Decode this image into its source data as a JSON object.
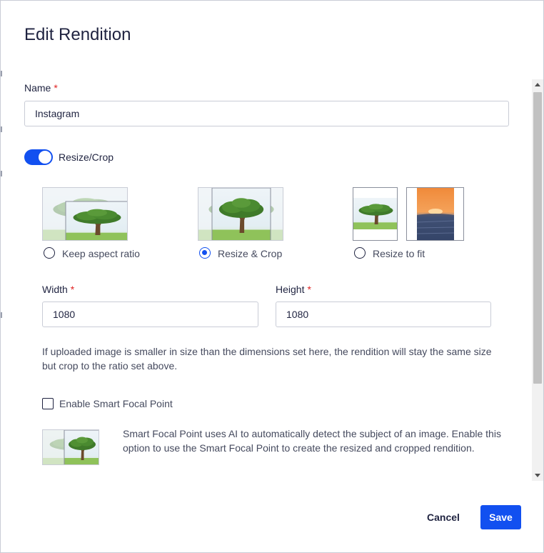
{
  "dialog": {
    "title": "Edit Rendition",
    "cancel_label": "Cancel",
    "save_label": "Save"
  },
  "form": {
    "name_label": "Name",
    "required_mark": "*",
    "name_value": "Instagram",
    "resize_crop_label": "Resize/Crop",
    "resize_crop_enabled": true,
    "options": [
      {
        "label": "Keep aspect ratio",
        "selected": false
      },
      {
        "label": "Resize & Crop",
        "selected": true
      },
      {
        "label": "Resize to fit",
        "selected": false
      }
    ],
    "width_label": "Width",
    "width_value": "1080",
    "height_label": "Height",
    "height_value": "1080",
    "size_note": "If uploaded image is smaller in size than the dimensions set here, the rendition will stay the same size but crop to the ratio set above.",
    "smart_focal_label": "Enable Smart Focal Point",
    "smart_focal_enabled": false,
    "smart_focal_description": "Smart Focal Point uses AI to automatically detect the subject of an image. Enable this option to use the Smart Focal Point to create the resized and cropped rendition."
  },
  "colors": {
    "accent": "#1250f0",
    "required": "#e02424",
    "text": "#1f2340"
  },
  "icons": {
    "keep_aspect_thumb": "tree-image-icon",
    "resize_crop_thumb": "tree-image-icon",
    "resize_fit_thumb_a": "tree-image-icon",
    "resize_fit_thumb_b": "sunset-image-icon",
    "smart_focal_thumb": "tree-image-icon"
  }
}
